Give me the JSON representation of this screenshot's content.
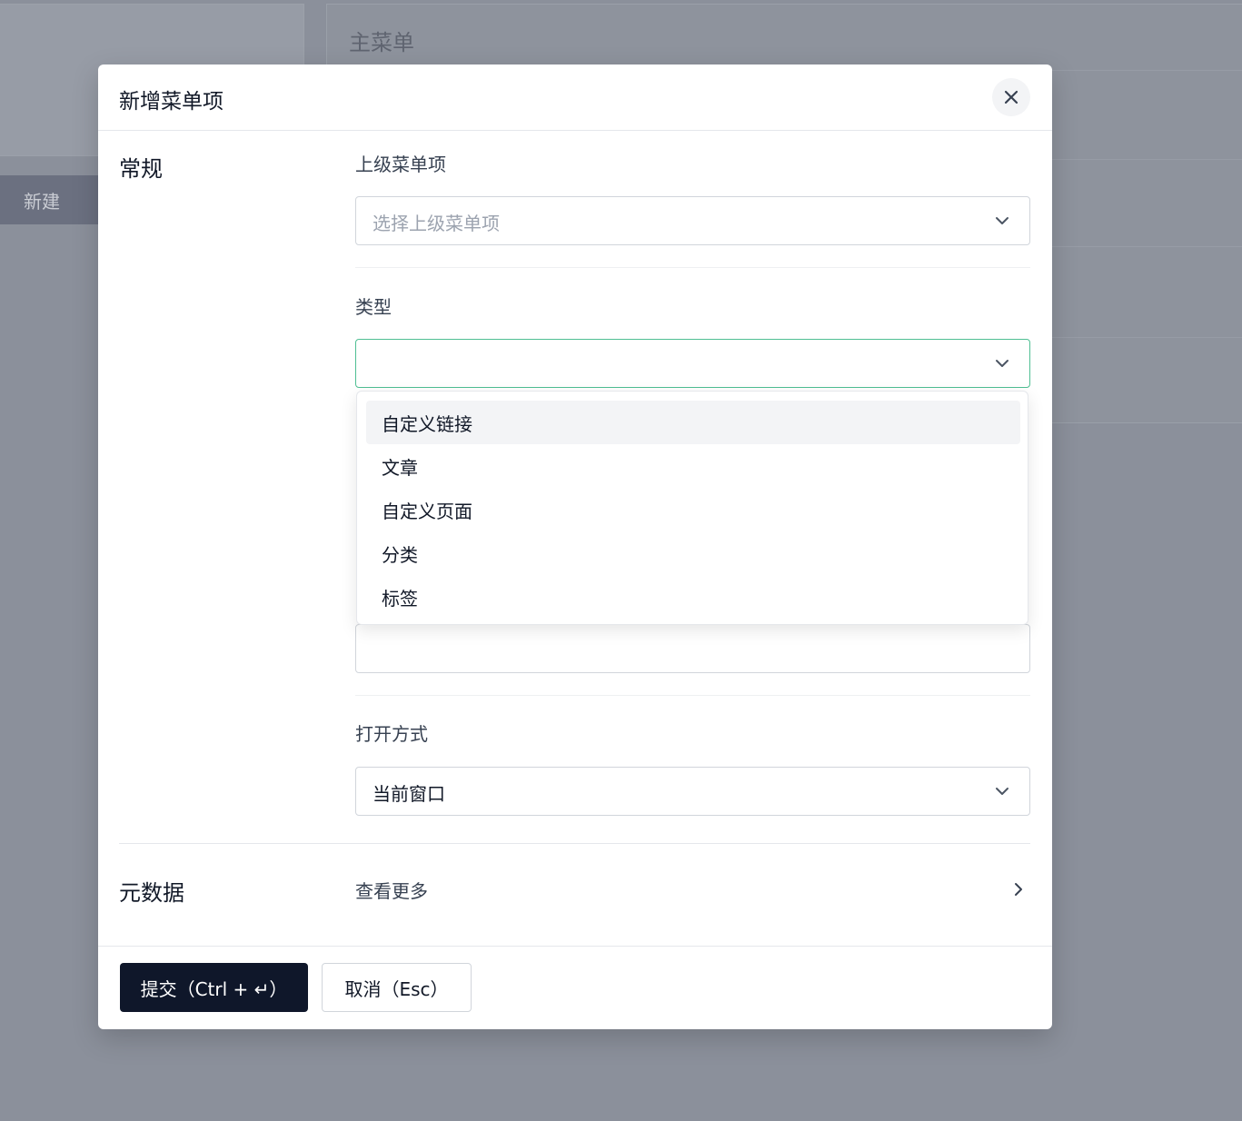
{
  "background": {
    "new_button_label": "新建",
    "menu_title": "主菜单"
  },
  "modal": {
    "title": "新增菜单项",
    "close_icon": "close-icon",
    "sections": {
      "general": "常规",
      "metadata": "元数据"
    },
    "fields": {
      "parent": {
        "label": "上级菜单项",
        "placeholder": "选择上级菜单项",
        "value": ""
      },
      "type": {
        "label": "类型",
        "value": "",
        "options": [
          "自定义链接",
          "文章",
          "自定义页面",
          "分类",
          "标签"
        ],
        "highlighted_option": "自定义链接"
      },
      "open_mode": {
        "label": "打开方式",
        "value": "当前窗口"
      }
    },
    "metadata_link": "查看更多",
    "footer": {
      "submit_label": "提交（Ctrl + ↵）",
      "cancel_label": "取消（Esc）"
    },
    "colors": {
      "primary_button": "#0f172a",
      "focus_border": "#4fbf93",
      "overlay": "#8b909b"
    }
  }
}
